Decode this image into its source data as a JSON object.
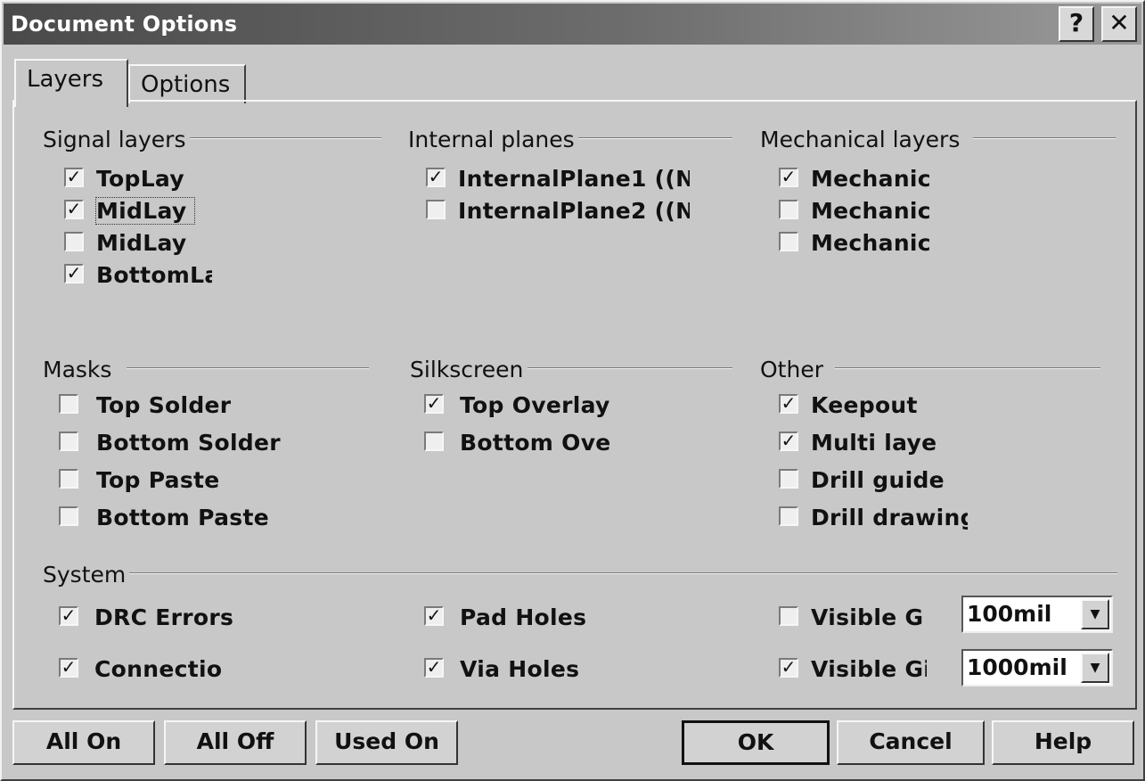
{
  "window": {
    "title": "Document Options",
    "help_glyph": "?",
    "close_glyph": "✕"
  },
  "tabs": [
    {
      "label": "Layers",
      "active": true
    },
    {
      "label": "Options",
      "active": false
    }
  ],
  "groups": {
    "signal": {
      "title": "Signal layers",
      "items": [
        {
          "label": "TopLay",
          "checked": true
        },
        {
          "label": "MidLay",
          "checked": true
        },
        {
          "label": "MidLay",
          "checked": false
        },
        {
          "label": "BottomLa",
          "checked": true
        }
      ]
    },
    "internal": {
      "title": "Internal planes",
      "items": [
        {
          "label": "InternalPlane1 ((N",
          "checked": true
        },
        {
          "label": "InternalPlane2 ((N",
          "checked": false
        }
      ]
    },
    "mechanical": {
      "title": "Mechanical layers",
      "items": [
        {
          "label": "Mechanic",
          "checked": true
        },
        {
          "label": "Mechanic",
          "checked": false
        },
        {
          "label": "Mechanic",
          "checked": false
        }
      ]
    },
    "masks": {
      "title": "Masks",
      "items": [
        {
          "label": "Top Solder",
          "checked": false
        },
        {
          "label": "Bottom Solder",
          "checked": false
        },
        {
          "label": "Top Paste",
          "checked": false
        },
        {
          "label": "Bottom Paste",
          "checked": false
        }
      ]
    },
    "silkscreen": {
      "title": "Silkscreen",
      "items": [
        {
          "label": "Top Overlay",
          "checked": true
        },
        {
          "label": "Bottom Over",
          "checked": false
        }
      ]
    },
    "other": {
      "title": "Other",
      "items": [
        {
          "label": "Keepout",
          "checked": true
        },
        {
          "label": "Multi laye",
          "checked": true
        },
        {
          "label": "Drill guide",
          "checked": false
        },
        {
          "label": "Drill drawing",
          "checked": false
        }
      ]
    },
    "system": {
      "title": "System",
      "items": [
        {
          "label": "DRC Errors",
          "checked": true
        },
        {
          "label": "Connectio",
          "checked": true
        },
        {
          "label": "Pad Holes",
          "checked": true
        },
        {
          "label": "Via Holes",
          "checked": true
        },
        {
          "label": "Visible Gri",
          "checked": false
        },
        {
          "label": "Visible Gi",
          "checked": true
        }
      ],
      "grid1_value": "100mil",
      "grid2_value": "1000mil"
    }
  },
  "check_glyph": "✓",
  "dropdown_glyph": "▼",
  "buttons": {
    "all_on": "All On",
    "all_off": "All Off",
    "used_on": "Used On",
    "ok": "OK",
    "cancel": "Cancel",
    "help": "Help"
  }
}
